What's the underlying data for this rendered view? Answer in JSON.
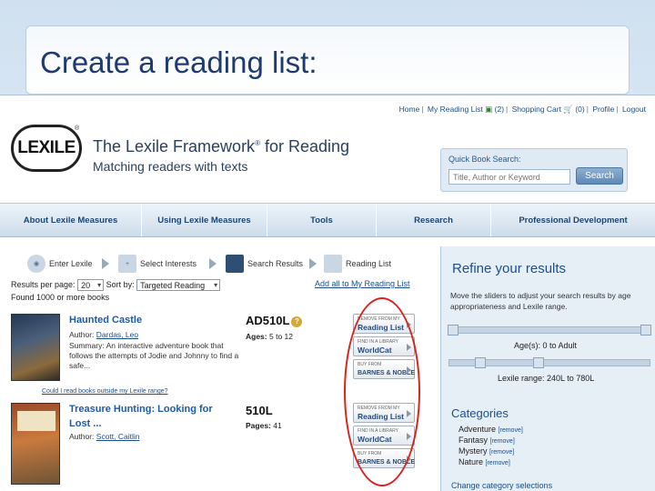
{
  "slide": {
    "title": "Create a reading list:"
  },
  "toplinks": {
    "home": "Home",
    "reading_list": "My Reading List",
    "reading_count": "(2)",
    "cart": "Shopping Cart",
    "cart_count": "(0)",
    "profile": "Profile",
    "logout": "Logout"
  },
  "logo": {
    "text": "LEXILE",
    "mark": "®"
  },
  "brand": {
    "title": "The Lexile Framework",
    "sup": "®",
    "title_end": " for Reading",
    "subtitle": "Matching readers with texts"
  },
  "quick_search": {
    "label": "Quick Book Search:",
    "placeholder": "Title, Author or Keyword",
    "button": "Search"
  },
  "nav": {
    "items": [
      "About Lexile Measures",
      "Using Lexile Measures",
      "Tools",
      "Research",
      "Professional Development"
    ]
  },
  "steps": [
    "Enter Lexile",
    "Select Interests",
    "Search Results",
    "Reading List"
  ],
  "results": {
    "per_page_label": "Results per page:",
    "per_page_value": "20",
    "sort_label": "Sort by:",
    "sort_value": "Targeted Reading",
    "add_all": "Add all to My Reading List",
    "found": "Found 1000 or more books"
  },
  "books": [
    {
      "title": "Haunted Castle",
      "author_label": "Author:",
      "author": "Dardas, Leo",
      "summary": "Summary: An interactive adventure book that follows the attempts of Jodie and Johnny to find a safe...",
      "lexile": "AD510L",
      "ages_label": "Ages:",
      "ages": "5 to 12"
    },
    {
      "title_line1": "Treasure Hunting: Looking for",
      "title_line2": "Lost ...",
      "author_label": "Author:",
      "author": "Scott, Caitlin",
      "lexile": "510L",
      "pages_label": "Pages:",
      "pages": "41"
    }
  ],
  "actions": {
    "remove_small": "REMOVE FROM MY",
    "remove_big": "Reading List",
    "library_small": "FIND IN A LIBRARY",
    "library_big": "WorldCat",
    "buy_small": "BUY FROM",
    "buy_big": "BARNES & NOBLE"
  },
  "refine": {
    "title": "Refine your results",
    "desc": "Move the sliders to adjust your search results by age appropriateness and Lexile range.",
    "age_label": "Age(s): 0 to Adult",
    "lexile_label": "Lexile range: 240L to 780L",
    "range_link": "Could I read books outside my Lexile range?",
    "categories_title": "Categories",
    "categories": [
      "Adventure",
      "Fantasy",
      "Mystery",
      "Nature"
    ],
    "remove_label": "[remove]",
    "change": "Change category selections"
  },
  "colors": {
    "link": "#1d4e89",
    "highlight_circle": "#d8231f",
    "nav_text": "#1d4570"
  }
}
